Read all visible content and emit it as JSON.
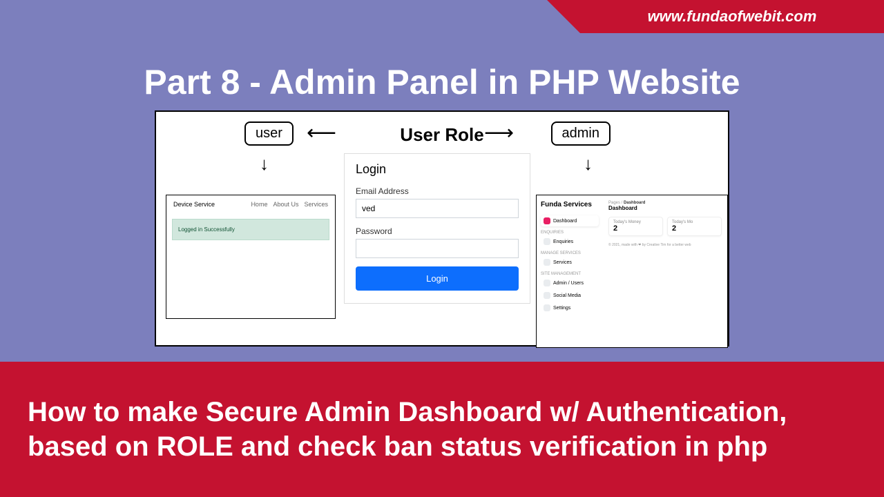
{
  "website_url": "www.fundaofwebit.com",
  "main_title": "Part 8 - Admin Panel in PHP Website",
  "roles": {
    "user": "user",
    "admin": "admin"
  },
  "user_role_title": "User Role",
  "login": {
    "title": "Login",
    "email_label": "Email Address",
    "email_value": "ved",
    "password_label": "Password",
    "button": "Login"
  },
  "user_site": {
    "brand": "Device Service",
    "nav": {
      "home": "Home",
      "about": "About Us",
      "services": "Services"
    },
    "success_msg": "Logged in Successfully"
  },
  "admin_dash": {
    "brand": "Funda Services",
    "breadcrumb_root": "Pages",
    "breadcrumb_current": "Dashboard",
    "heading": "Dashboard",
    "sidebar": {
      "dashboard": "Dashboard",
      "section_enq": "ENQUIRIES",
      "enquiries": "Enquiries",
      "section_svc": "MANAGE SERVICES",
      "services": "Services",
      "section_mgmt": "SITE MANAGEMENT",
      "admin_users": "Admin / Users",
      "social_media": "Social Media",
      "settings": "Settings"
    },
    "stats": {
      "label1": "Today's Money",
      "value1": "2",
      "label2": "Today's Mo",
      "value2": "2"
    },
    "footer": "© 2021, made with ❤ by Creative Tim for a better web"
  },
  "bottom_text": "How to make Secure Admin Dashboard w/ Authentication, based on ROLE and check ban status verification in php"
}
